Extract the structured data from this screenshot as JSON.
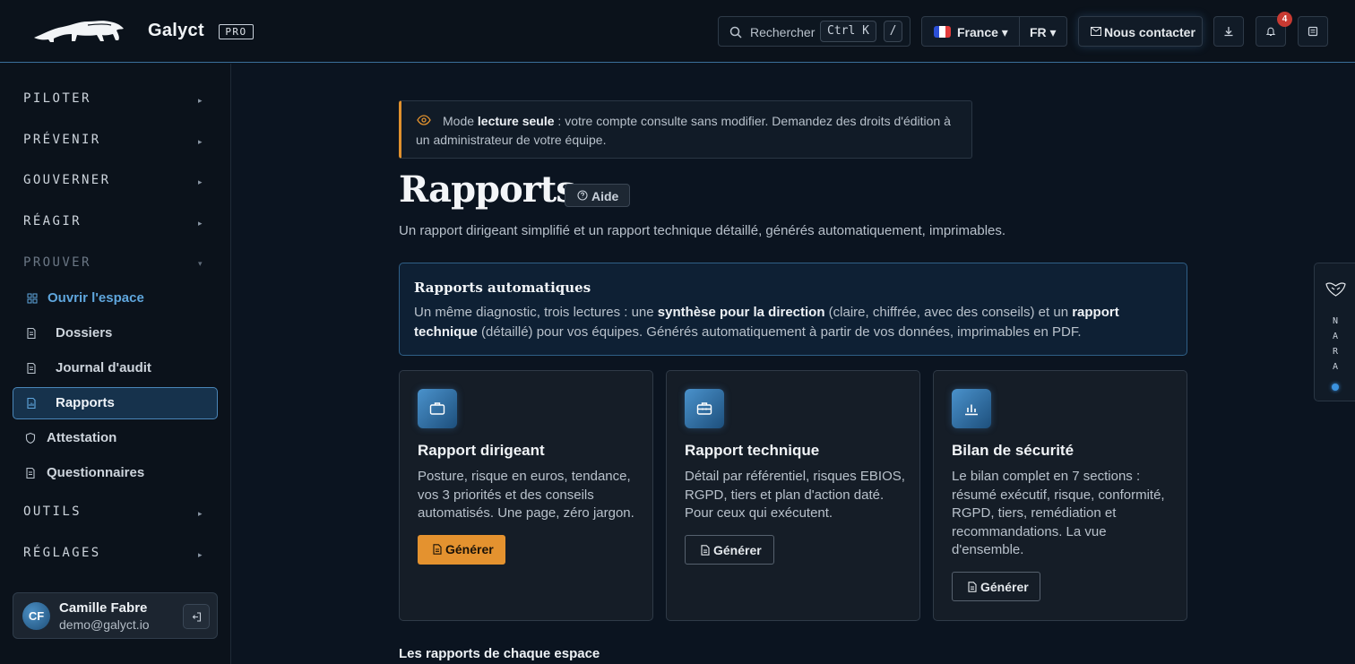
{
  "header": {
    "brand": "Galyct",
    "plan_badge": "PRO",
    "search_label": "Rechercher",
    "search_shortcut": "Ctrl K",
    "search_slash": "/",
    "country": "France ▾",
    "language": "FR ▾",
    "contact_label": "Nous contacter",
    "notifications_count": "4",
    "flag_colors": [
      "#2b4fd6",
      "#ffffff",
      "#e23b3b"
    ]
  },
  "sidebar": {
    "sections": [
      {
        "label": "PILOTER",
        "arrow": "▸"
      },
      {
        "label": "PRÉVENIR",
        "arrow": "▸"
      },
      {
        "label": "GOUVERNER",
        "arrow": "▸"
      },
      {
        "label": "RÉAGIR",
        "arrow": "▸"
      },
      {
        "label": "PROUVER",
        "arrow": "▾"
      },
      {
        "label": "OUTILS",
        "arrow": "▸"
      },
      {
        "label": "RÉGLAGES",
        "arrow": "▸"
      }
    ],
    "items": [
      {
        "label": "Ouvrir l'espace",
        "icon": "grid-icon"
      },
      {
        "label": "Dossiers",
        "icon": "document-icon"
      },
      {
        "label": "Journal d'audit",
        "icon": "document-icon"
      },
      {
        "label": "Rapports",
        "icon": "report-icon"
      },
      {
        "label": "Attestation",
        "icon": "shield-icon"
      },
      {
        "label": "Questionnaires",
        "icon": "document-icon"
      }
    ],
    "user": {
      "initials": "CF",
      "name": "Camille Fabre",
      "email": "demo@galyct.io"
    }
  },
  "main": {
    "notice": {
      "prefix": "Mode ",
      "bold": "lecture seule",
      "suffix": " : votre compte consulte sans modifier. Demandez des droits d'édition à un administrateur de votre équipe."
    },
    "title": "Rapports",
    "help_label": "Aide",
    "subtitle": "Un rapport dirigeant simplifié et un rapport technique détaillé, générés automatiquement, imprimables.",
    "info": {
      "title": "Rapports automatiques",
      "p1": "Un même diagnostic, trois lectures : une ",
      "b1": "synthèse pour la direction",
      "p2": " (claire, chiffrée, avec des conseils) et un ",
      "b2": "rapport technique",
      "p3": " (détaillé) pour vos équipes. Générés automatiquement à partir de vos données, imprimables en PDF."
    },
    "cards": [
      {
        "title": "Rapport dirigeant",
        "desc": "Posture, risque en euros, tendance, vos 3 priorités et des conseils automatisés. Une page, zéro jargon.",
        "button": "Générer",
        "icon": "briefcase-icon"
      },
      {
        "title": "Rapport technique",
        "desc": "Détail par référentiel, risques EBIOS, RGPD, tiers et plan d'action daté. Pour ceux qui exécutent.",
        "button": "Générer",
        "icon": "toolbox-icon"
      },
      {
        "title": "Bilan de sécurité",
        "desc": "Le bilan complet en 7 sections : résumé exécutif, risque, conformité, RGPD, tiers, remédiation et recommandations. La vue d'ensemble.",
        "button": "Générer",
        "icon": "bar-chart-icon"
      }
    ],
    "section_heading": "Les rapports de chaque espace"
  },
  "assistant": {
    "letters": [
      "N",
      "A",
      "R",
      "A"
    ]
  },
  "colors": {
    "accent": "#e4922f",
    "link": "#5fa6dd",
    "active_border": "#4a86b8"
  }
}
